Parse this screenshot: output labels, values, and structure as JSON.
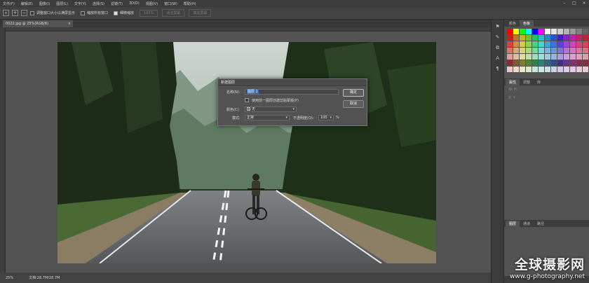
{
  "menu": [
    "文件(F)",
    "编辑(E)",
    "图像(I)",
    "图层(L)",
    "文字(Y)",
    "选择(S)",
    "滤镜(T)",
    "3D(D)",
    "视图(V)",
    "窗口(W)",
    "帮助(H)"
  ],
  "options_bar": {
    "resize_label": "调整窗口大小以满屏显示",
    "zoom_all_label": "缩放所有窗口",
    "scrubby_label": "细微缩放",
    "zoom_value": "100%",
    "fit_screen_label": "适合屏幕",
    "fill_screen_label": "填充屏幕"
  },
  "document_tab": {
    "title": "0022.jpg @ 25%(RGB/8)",
    "close": "×"
  },
  "status": {
    "zoom": "25%",
    "doc_size": "文档:28.7M/28.7M"
  },
  "panels": {
    "top_tabs": [
      "颜色",
      "色板"
    ],
    "mid_tabs": [
      "属性",
      "调整",
      "库"
    ],
    "layers_tabs": [
      "图层",
      "通道",
      "路径"
    ],
    "props_rows": [
      "W:  H:",
      "X:  Y:"
    ]
  },
  "dialog": {
    "title": "新建图层",
    "name_label": "名称(N):",
    "name_value": "图层 1",
    "use_clip_label": "使用前一图层创建剪贴蒙版(P)",
    "color_label": "颜色(C):",
    "color_value": "无",
    "mode_label": "模式:",
    "mode_value": "正常",
    "opacity_label": "不透明度(O):",
    "opacity_value": "100",
    "percent": "%",
    "ok_label": "确定",
    "cancel_label": "取消"
  },
  "watermark": {
    "cn": "全球摄影网",
    "url": "www.g-photography.net"
  }
}
